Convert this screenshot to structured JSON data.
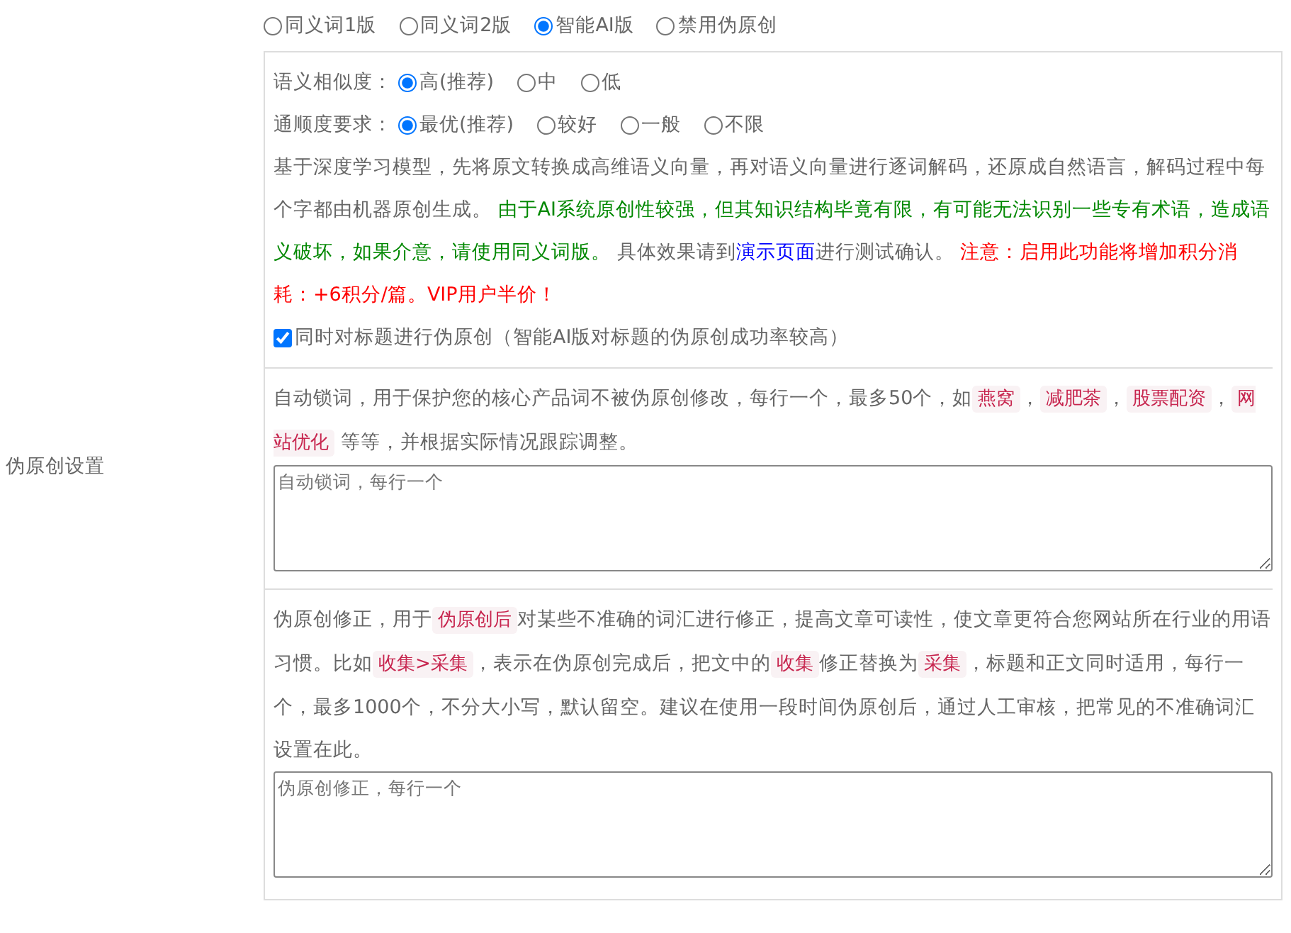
{
  "sidebar_label": "伪原创设置",
  "modes": [
    {
      "label": "同义词1版",
      "selected": false
    },
    {
      "label": "同义词2版",
      "selected": false
    },
    {
      "label": "智能AI版",
      "selected": true
    },
    {
      "label": "禁用伪原创",
      "selected": false
    }
  ],
  "settings": [
    {
      "label": "语义相似度：",
      "options": [
        {
          "label": "高(推荐)",
          "selected": true
        },
        {
          "label": "中",
          "selected": false
        },
        {
          "label": "低",
          "selected": false
        }
      ]
    },
    {
      "label": "通顺度要求：",
      "options": [
        {
          "label": "最优(推荐)",
          "selected": true
        },
        {
          "label": "较好",
          "selected": false
        },
        {
          "label": "一般",
          "selected": false
        },
        {
          "label": "不限",
          "selected": false
        }
      ]
    }
  ],
  "description": [
    {
      "kind": "text",
      "text": "基于深度学习模型，先将原文转换成高维语义向量，再对语义向量进行逐词解码，还原成自然语言，解码过程中每个字都由机器原创生成。 "
    },
    {
      "kind": "green",
      "text": "由于AI系统原创性较强，但其知识结构毕竟有限，有可能无法识别一些专有术语，造成语义破坏，如果介意，请使用同义词版。"
    },
    {
      "kind": "text",
      "text": " 具体效果请到"
    },
    {
      "kind": "link",
      "text": "演示页面"
    },
    {
      "kind": "text",
      "text": "进行测试确认。 "
    },
    {
      "kind": "red",
      "text": "注意：启用此功能将增加积分消耗：+6积分/篇。VIP用户半价！"
    }
  ],
  "title_option": {
    "label": "同时对标题进行伪原创（智能AI版对标题的伪原创成功率较高）",
    "checked": true
  },
  "lock_words": {
    "description": [
      {
        "kind": "text",
        "text": "自动锁词，用于保护您的核心产品词不被伪原创修改，每行一个，最多50个，如"
      },
      {
        "kind": "code",
        "text": "燕窝"
      },
      {
        "kind": "text",
        "text": "，"
      },
      {
        "kind": "code",
        "text": "减肥茶"
      },
      {
        "kind": "text",
        "text": "，"
      },
      {
        "kind": "code",
        "text": "股票配资"
      },
      {
        "kind": "text",
        "text": "，"
      },
      {
        "kind": "code",
        "text": "网站优化"
      },
      {
        "kind": "text",
        "text": " 等等，并根据实际情况跟踪调整。"
      }
    ],
    "placeholder": "自动锁词，每行一个"
  },
  "corrections": {
    "description": [
      {
        "kind": "text",
        "text": "伪原创修正，用于"
      },
      {
        "kind": "code",
        "text": "伪原创后"
      },
      {
        "kind": "text",
        "text": "对某些不准确的词汇进行修正，提高文章可读性，使文章更符合您网站所在行业的用语习惯。比如"
      },
      {
        "kind": "code",
        "text": "收集>采集"
      },
      {
        "kind": "text",
        "text": "，表示在伪原创完成后，把文中的"
      },
      {
        "kind": "code",
        "text": "收集"
      },
      {
        "kind": "text",
        "text": "修正替换为"
      },
      {
        "kind": "code",
        "text": "采集"
      },
      {
        "kind": "text",
        "text": "，标题和正文同时适用，每行一个，最多1000个，不分大小写，默认留空。建议在使用一段时间伪原创后，通过人工审核，把常见的不准确词汇设置在此。"
      }
    ],
    "placeholder": "伪原创修正，每行一个"
  }
}
